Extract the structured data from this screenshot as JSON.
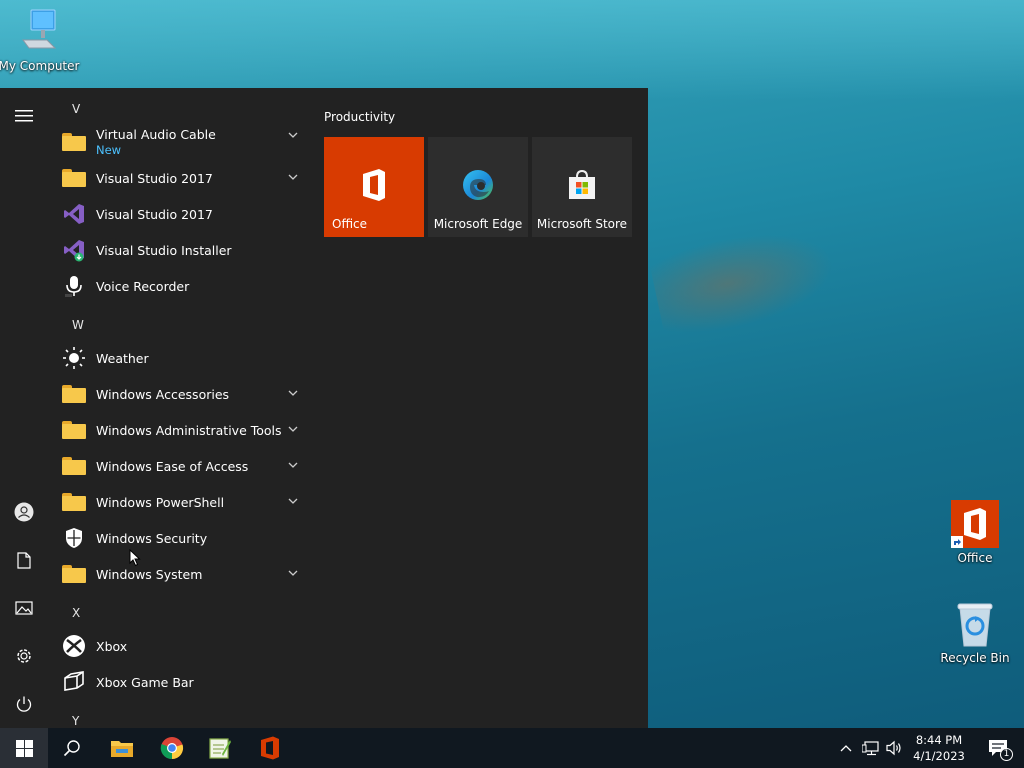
{
  "desktop": {
    "icons": [
      {
        "label": "My Computer"
      },
      {
        "label": "Office"
      },
      {
        "label": "Recycle Bin"
      }
    ]
  },
  "start_menu": {
    "letters": [
      "V",
      "W",
      "X",
      "Y"
    ],
    "apps": [
      {
        "name": "Virtual Audio Cable",
        "sub": "New",
        "icon": "folder-icon",
        "expandable": true
      },
      {
        "name": "Visual Studio 2017",
        "icon": "folder-icon",
        "expandable": true
      },
      {
        "name": "Visual Studio 2017",
        "icon": "visual-studio-icon"
      },
      {
        "name": "Visual Studio Installer",
        "icon": "visual-studio-installer-icon"
      },
      {
        "name": "Voice Recorder",
        "icon": "microphone-icon"
      },
      {
        "name": "Weather",
        "icon": "sun-icon"
      },
      {
        "name": "Windows Accessories",
        "icon": "folder-icon",
        "expandable": true
      },
      {
        "name": "Windows Administrative Tools",
        "icon": "folder-icon",
        "expandable": true
      },
      {
        "name": "Windows Ease of Access",
        "icon": "folder-icon",
        "expandable": true
      },
      {
        "name": "Windows PowerShell",
        "icon": "folder-icon",
        "expandable": true
      },
      {
        "name": "Windows Security",
        "icon": "shield-icon"
      },
      {
        "name": "Windows System",
        "icon": "folder-icon",
        "expandable": true
      },
      {
        "name": "Xbox",
        "icon": "xbox-icon"
      },
      {
        "name": "Xbox Game Bar",
        "icon": "game-bar-icon"
      }
    ],
    "tiles_group": "Productivity",
    "tiles": [
      {
        "name": "Office",
        "color": "#d83b01"
      },
      {
        "name": "Microsoft Edge",
        "color": "#2d2d2d"
      },
      {
        "name": "Microsoft Store",
        "color": "#2d2d2d"
      }
    ]
  },
  "taskbar": {
    "time": "8:44 PM",
    "date": "4/1/2023",
    "notification_count": "1"
  }
}
